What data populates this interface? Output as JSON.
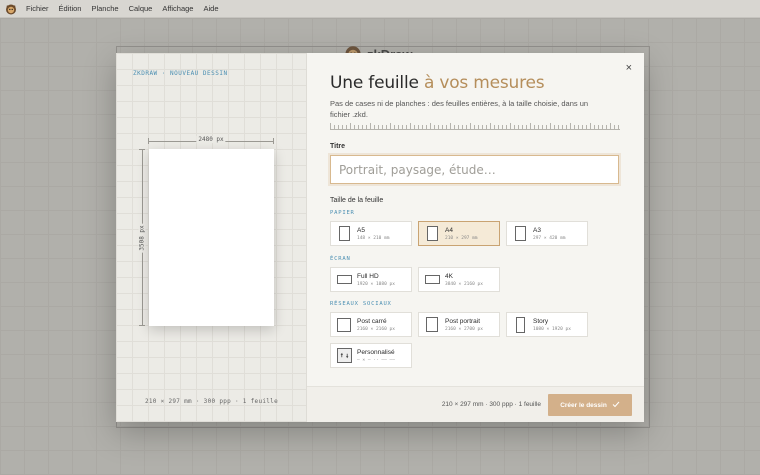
{
  "menubar": {
    "items": [
      "Fichier",
      "Édition",
      "Planche",
      "Calque",
      "Affichage",
      "Aide"
    ]
  },
  "background": {
    "brand": "zkDraw"
  },
  "preview": {
    "breadcrumb": "ZKDRAW · NOUVEAU DESSIN",
    "width_label": "2480 px",
    "height_label": "3508 px",
    "info": "210 × 297 mm · 300 ppp · 1 feuille"
  },
  "dialog": {
    "title_main": "Une feuille ",
    "title_accent": "à vos mesures",
    "subtitle": "Pas de cases ni de planches : des feuilles entières, à la taille choisie, dans un fichier .zkd.",
    "close_glyph": "×",
    "title_field_label": "Titre",
    "title_placeholder": "Portrait, paysage, étude…",
    "size_label": "Taille de la feuille",
    "sections": {
      "paper": "PAPIER",
      "screen": "ÉCRAN",
      "social": "RÉSEAUX SOCIAUX"
    },
    "presets": {
      "paper": [
        {
          "name": "A5",
          "dims": "148 × 210 mm",
          "icon": "portrait-sheet-icon"
        },
        {
          "name": "A4",
          "dims": "210 × 297 mm",
          "icon": "portrait-sheet-icon",
          "selected": true
        },
        {
          "name": "A3",
          "dims": "297 × 420 mm",
          "icon": "portrait-sheet-icon"
        }
      ],
      "screen": [
        {
          "name": "Full HD",
          "dims": "1920 × 1080 px",
          "icon": "landscape-sheet-icon"
        },
        {
          "name": "4K",
          "dims": "3840 × 2160 px",
          "icon": "landscape-sheet-icon"
        }
      ],
      "social": [
        {
          "name": "Post carré",
          "dims": "2160 × 2160 px",
          "icon": "square-sheet-icon"
        },
        {
          "name": "Post portrait",
          "dims": "2160 × 2700 px",
          "icon": "portrait-sheet-icon"
        },
        {
          "name": "Story",
          "dims": "1080 × 1920 px",
          "icon": "tall-sheet-icon"
        },
        {
          "name": "Personnalisé",
          "dims": "— × — ·· —— ——",
          "icon": "resize-icon"
        }
      ]
    },
    "footer_summary": "210 × 297 mm · 300 ppp · 1 feuille",
    "create_label": "Créer le dessin",
    "create_icon": "check-icon"
  },
  "colors": {
    "accent": "#b58e5b",
    "primary_button": "#d3b08a",
    "section_label": "#4b8fb2"
  }
}
